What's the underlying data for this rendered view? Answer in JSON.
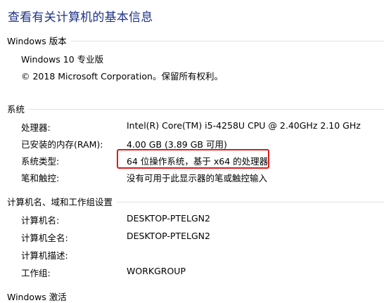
{
  "page_title": "查看有关计算机的基本信息",
  "windows_edition": {
    "header": "Windows 版本",
    "edition": "Windows 10 专业版",
    "copyright": "© 2018 Microsoft Corporation。保留所有权利。"
  },
  "system": {
    "header": "系统",
    "rows": [
      {
        "label": "处理器:",
        "value": "Intel(R) Core(TM) i5-4258U CPU @ 2.40GHz   2.10 GHz"
      },
      {
        "label": "已安装的内存(RAM):",
        "value": "4.00 GB (3.89 GB 可用)"
      },
      {
        "label": "系统类型:",
        "value": "64 位操作系统，基于 x64 的处理器"
      },
      {
        "label": "笔和触控:",
        "value": "没有可用于此显示器的笔或触控输入"
      }
    ]
  },
  "computer_name": {
    "header": "计算机名、域和工作组设置",
    "rows": [
      {
        "label": "计算机名:",
        "value": "DESKTOP-PTELGN2"
      },
      {
        "label": "计算机全名:",
        "value": "DESKTOP-PTELGN2"
      },
      {
        "label": "计算机描述:",
        "value": ""
      },
      {
        "label": "工作组:",
        "value": "WORKGROUP"
      }
    ]
  },
  "activation": {
    "header": "Windows 激活"
  },
  "colors": {
    "title": "#1e3287",
    "highlight": "#e21a1a",
    "divider": "#e3e3e3"
  }
}
